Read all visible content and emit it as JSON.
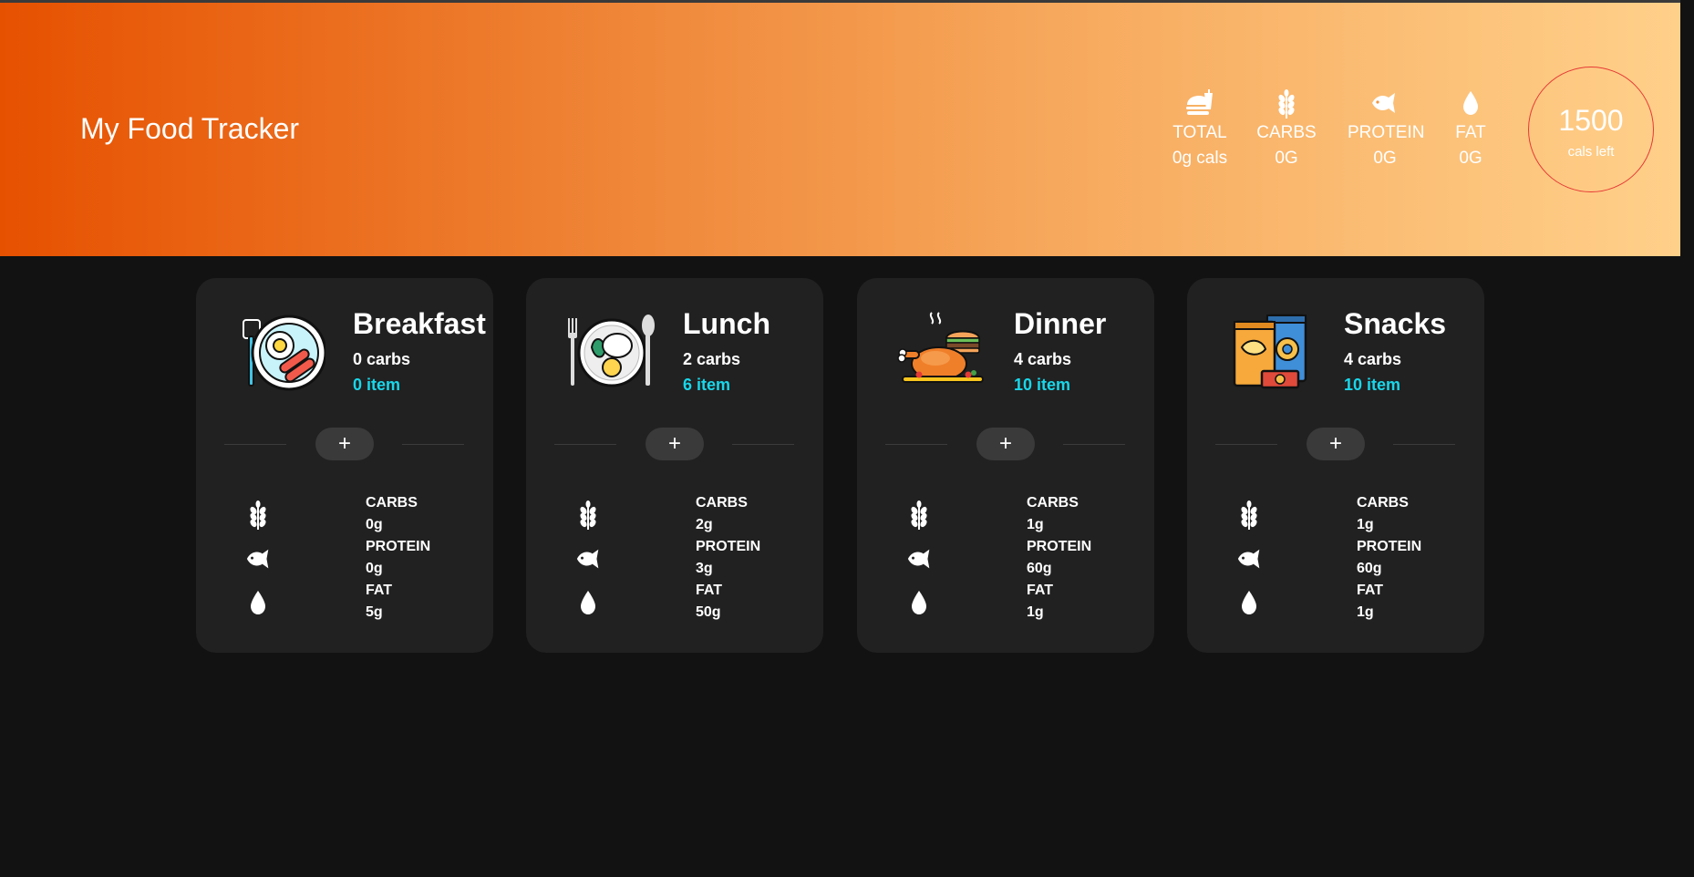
{
  "header": {
    "title": "My Food Tracker",
    "stats": [
      {
        "label": "TOTAL",
        "value": "0g cals",
        "icon": "fast-food-icon"
      },
      {
        "label": "CARBS",
        "value": "0G",
        "icon": "wheat-icon"
      },
      {
        "label": "PROTEIN",
        "value": "0G",
        "icon": "fish-icon"
      },
      {
        "label": "FAT",
        "value": "0G",
        "icon": "drop-icon"
      }
    ],
    "cals_left": {
      "value": "1500",
      "label": "cals left"
    }
  },
  "meals": [
    {
      "name": "Breakfast",
      "carbs_summary": "0 carbs",
      "items": "0 item",
      "add": "+",
      "icon": "breakfast-plate-icon",
      "macros": {
        "carbs_label": "CARBS",
        "carbs": "0g",
        "protein_label": "PROTEIN",
        "protein": "0g",
        "fat_label": "FAT",
        "fat": "5g"
      }
    },
    {
      "name": "Lunch",
      "carbs_summary": "2 carbs",
      "items": "6 item",
      "add": "+",
      "icon": "lunch-plate-icon",
      "macros": {
        "carbs_label": "CARBS",
        "carbs": "2g",
        "protein_label": "PROTEIN",
        "protein": "3g",
        "fat_label": "FAT",
        "fat": "50g"
      }
    },
    {
      "name": "Dinner",
      "carbs_summary": "4 carbs",
      "items": "10 item",
      "add": "+",
      "icon": "dinner-chicken-icon",
      "macros": {
        "carbs_label": "CARBS",
        "carbs": "1g",
        "protein_label": "PROTEIN",
        "protein": "60g",
        "fat_label": "FAT",
        "fat": "1g"
      }
    },
    {
      "name": "Snacks",
      "carbs_summary": "4 carbs",
      "items": "10 item",
      "add": "+",
      "icon": "snack-bags-icon",
      "macros": {
        "carbs_label": "CARBS",
        "carbs": "1g",
        "protein_label": "PROTEIN",
        "protein": "60g",
        "fat_label": "FAT",
        "fat": "1g"
      }
    }
  ],
  "colors": {
    "accent_item": "#18d7ea",
    "card_bg": "#212121",
    "page_bg": "#121212",
    "ring": "#e53935"
  }
}
